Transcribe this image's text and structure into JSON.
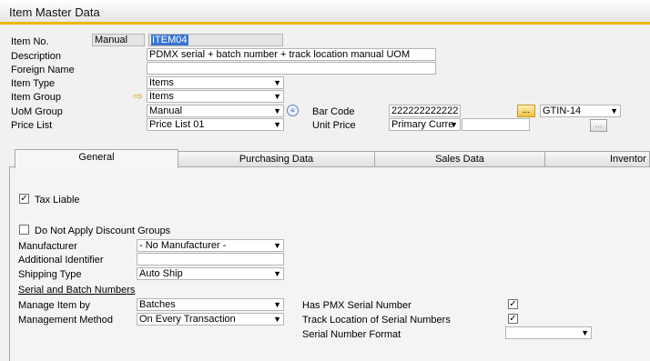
{
  "window": {
    "title": "Item Master Data"
  },
  "header": {
    "item_no_label": "Item No.",
    "item_no_series": "Manual",
    "item_no_value": "ITEM04",
    "description_label": "Description",
    "description_value": "PDMX serial + batch number + track location manual UOM",
    "foreign_name_label": "Foreign Name",
    "foreign_name_value": "",
    "item_type_label": "Item Type",
    "item_type_value": "Items",
    "item_group_label": "Item Group",
    "item_group_value": "Items",
    "uom_group_label": "UoM Group",
    "uom_group_value": "Manual",
    "price_list_label": "Price List",
    "price_list_value": "Price List 01",
    "bar_code_label": "Bar Code",
    "bar_code_value": "222222222222",
    "bar_code_button": "...",
    "bar_code_type": "GTIN-14",
    "unit_price_label": "Unit Price",
    "unit_price_currency": "Primary Curre",
    "unit_price_value": "",
    "unit_price_button": "..."
  },
  "tabs": [
    {
      "label": "General"
    },
    {
      "label": "Purchasing Data"
    },
    {
      "label": "Sales Data"
    },
    {
      "label": "Inventor"
    }
  ],
  "general": {
    "tax_liable_label": "Tax Liable",
    "tax_liable_checked": true,
    "no_discount_label": "Do Not Apply Discount Groups",
    "no_discount_checked": false,
    "manufacturer_label": "Manufacturer",
    "manufacturer_value": "- No Manufacturer -",
    "additional_id_label": "Additional Identifier",
    "additional_id_value": "",
    "shipping_type_label": "Shipping Type",
    "shipping_type_value": "Auto Ship",
    "serial_batch_heading": "Serial and Batch Numbers",
    "manage_item_by_label": "Manage Item by",
    "manage_item_by_value": "Batches",
    "management_method_label": "Management Method",
    "management_method_value": "On Every Transaction",
    "has_pmx_serial_label": "Has PMX Serial Number",
    "has_pmx_serial_checked": true,
    "track_location_label": "Track Location of Serial Numbers",
    "track_location_checked": true,
    "serial_format_label": "Serial Number Format",
    "serial_format_value": ""
  },
  "icons": {
    "dropdown": "▼",
    "check": "✓",
    "link_arrow": "⇨",
    "uom_info": "≡"
  }
}
